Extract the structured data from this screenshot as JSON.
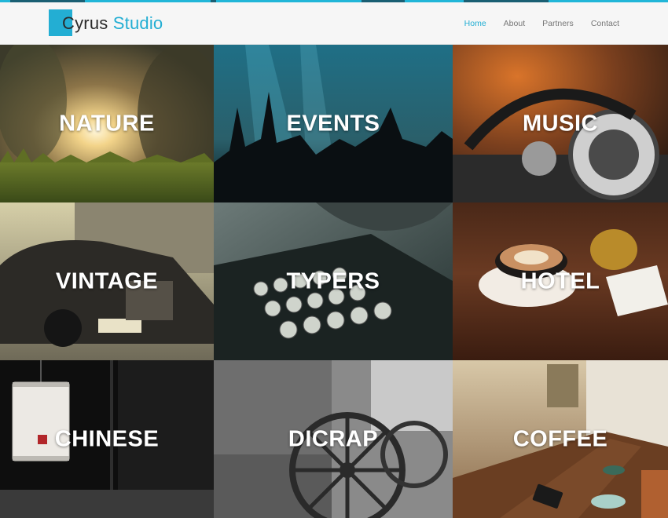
{
  "brand": {
    "first": "Cyrus",
    "second": "Studio"
  },
  "nav": [
    {
      "label": "Home",
      "active": true
    },
    {
      "label": "About",
      "active": false
    },
    {
      "label": "Partners",
      "active": false
    },
    {
      "label": "Contact",
      "active": false
    }
  ],
  "tiles": [
    {
      "label": "NATURE"
    },
    {
      "label": "EVENTS"
    },
    {
      "label": "MUSIC"
    },
    {
      "label": "VINTAGE"
    },
    {
      "label": "TYPERS"
    },
    {
      "label": "HOTEL"
    },
    {
      "label": "CHINESE"
    },
    {
      "label": "DICRAP"
    },
    {
      "label": "COFFEE"
    }
  ],
  "colors": {
    "accent": "#23aed3",
    "header_bg": "#f6f6f6",
    "stripe_dark": "#1a5f73"
  }
}
